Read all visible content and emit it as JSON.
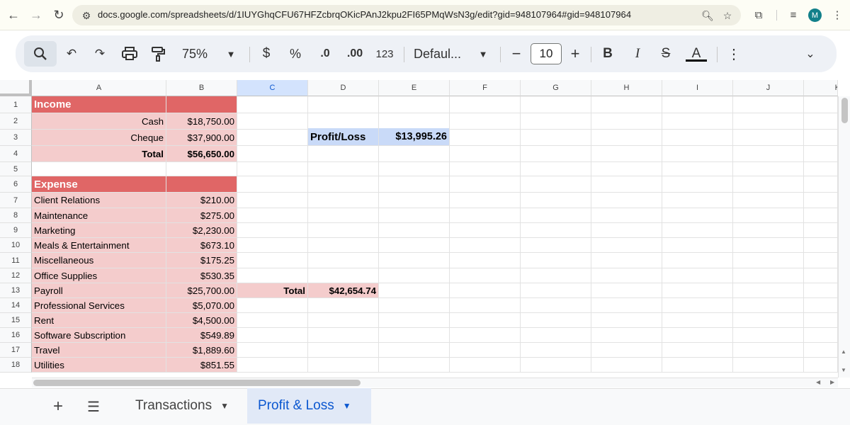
{
  "browser": {
    "url": "docs.google.com/spreadsheets/d/1IUYGhqCFU67HFZcbrqOKicPAnJ2kpu2FI65PMqWsN3g/edit?gid=948107964#gid=948107964",
    "avatar_letter": "M",
    "avatar_color": "#12808a"
  },
  "toolbar": {
    "zoom": "75%",
    "currency": "$",
    "percent": "%",
    "decrease_decimal": ".0",
    "increase_decimal": ".00",
    "number_format": "123",
    "font": "Defaul...",
    "font_size": "10",
    "bold": "B",
    "italic": "I",
    "strike": "S",
    "text_color": "A"
  },
  "columns": [
    "A",
    "B",
    "C",
    "D",
    "E",
    "F",
    "G",
    "H",
    "I",
    "J",
    "K"
  ],
  "rows": [
    "1",
    "2",
    "3",
    "4",
    "5",
    "6",
    "7",
    "8",
    "9",
    "10",
    "11",
    "12",
    "13",
    "14",
    "15",
    "16",
    "17",
    "18"
  ],
  "income": {
    "header": "Income",
    "cash_label": "Cash",
    "cash_value": "$18,750.00",
    "cheque_label": "Cheque",
    "cheque_value": "$37,900.00",
    "total_label": "Total",
    "total_value": "$56,650.00"
  },
  "profit_loss": {
    "label": "Profit/Loss",
    "value": "$13,995.26"
  },
  "expense": {
    "header": "Expense",
    "items": [
      {
        "label": "Client Relations",
        "value": "$210.00"
      },
      {
        "label": "Maintenance",
        "value": "$275.00"
      },
      {
        "label": "Marketing",
        "value": "$2,230.00"
      },
      {
        "label": "Meals & Entertainment",
        "value": "$673.10"
      },
      {
        "label": "Miscellaneous",
        "value": "$175.25"
      },
      {
        "label": "Office Supplies",
        "value": "$530.35"
      },
      {
        "label": "Payroll",
        "value": "$25,700.00"
      },
      {
        "label": "Professional Services",
        "value": "$5,070.00"
      },
      {
        "label": "Rent",
        "value": "$4,500.00"
      },
      {
        "label": "Software Subscription",
        "value": "$549.89"
      },
      {
        "label": "Travel",
        "value": "$1,889.60"
      },
      {
        "label": "Utilities",
        "value": "$851.55"
      }
    ],
    "total_label": "Total",
    "total_value": "$42,654.74"
  },
  "sheets": {
    "tabs": [
      "Transactions",
      "Profit & Loss"
    ],
    "active": "Profit & Loss"
  },
  "colors": {
    "header_red": "#e06666",
    "pink": "#f4cccc",
    "blue": "#c9daf8",
    "accent": "#0b57d0"
  }
}
